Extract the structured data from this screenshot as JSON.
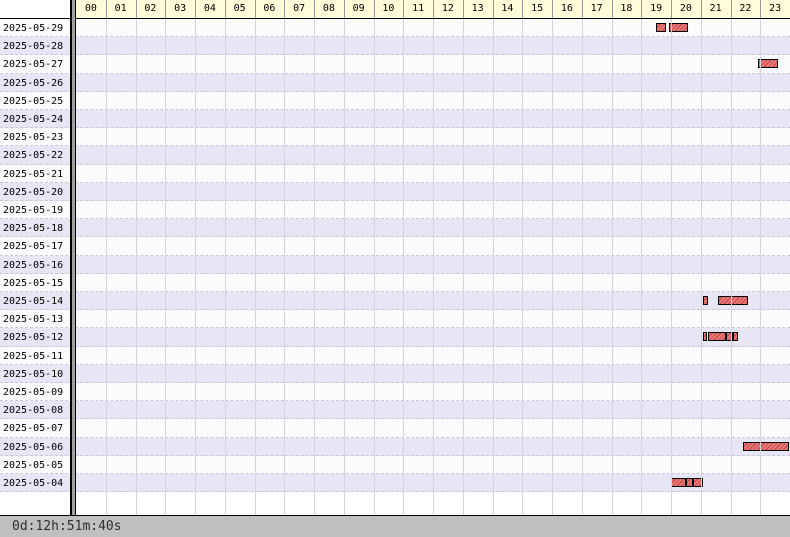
{
  "columns": [
    "00",
    "01",
    "02",
    "03",
    "04",
    "05",
    "06",
    "07",
    "08",
    "09",
    "10",
    "11",
    "12",
    "13",
    "14",
    "15",
    "16",
    "17",
    "18",
    "19",
    "20",
    "21",
    "22",
    "23"
  ],
  "rows": [
    {
      "date": "2025-05-29",
      "mark": false,
      "sessions": [
        {
          "start": "19:30",
          "end": "19:50"
        },
        {
          "start": "19:55",
          "end": "20:35"
        }
      ]
    },
    {
      "date": "2025-05-28",
      "mark": true,
      "sessions": []
    },
    {
      "date": "2025-05-27",
      "mark": false,
      "sessions": [
        {
          "start": "22:55",
          "end": "23:35"
        }
      ]
    },
    {
      "date": "2025-05-26",
      "mark": true,
      "sessions": []
    },
    {
      "date": "2025-05-25",
      "mark": true,
      "sessions": []
    },
    {
      "date": "2025-05-24",
      "mark": true,
      "sessions": []
    },
    {
      "date": "2025-05-23",
      "mark": true,
      "sessions": []
    },
    {
      "date": "2025-05-22",
      "mark": true,
      "sessions": []
    },
    {
      "date": "2025-05-21",
      "mark": true,
      "sessions": []
    },
    {
      "date": "2025-05-20",
      "mark": true,
      "sessions": []
    },
    {
      "date": "2025-05-19",
      "mark": true,
      "sessions": []
    },
    {
      "date": "2025-05-18",
      "mark": true,
      "sessions": []
    },
    {
      "date": "2025-05-17",
      "mark": true,
      "sessions": []
    },
    {
      "date": "2025-05-16",
      "mark": true,
      "sessions": []
    },
    {
      "date": "2025-05-15",
      "mark": true,
      "sessions": []
    },
    {
      "date": "2025-05-14",
      "mark": false,
      "sessions": [
        {
          "start": "21:05",
          "end": "21:15"
        },
        {
          "start": "21:35",
          "end": "22:35"
        }
      ]
    },
    {
      "date": "2025-05-13",
      "mark": true,
      "sessions": []
    },
    {
      "date": "2025-05-12",
      "mark": false,
      "sessions": [
        {
          "start": "21:05",
          "end": "21:10"
        },
        {
          "start": "21:15",
          "end": "21:50"
        },
        {
          "start": "21:50",
          "end": "22:05"
        },
        {
          "start": "22:05",
          "end": "22:15"
        }
      ]
    },
    {
      "date": "2025-05-11",
      "mark": true,
      "sessions": []
    },
    {
      "date": "2025-05-10",
      "mark": true,
      "sessions": []
    },
    {
      "date": "2025-05-09",
      "mark": true,
      "sessions": []
    },
    {
      "date": "2025-05-08",
      "mark": true,
      "sessions": []
    },
    {
      "date": "2025-05-07",
      "mark": true,
      "sessions": []
    },
    {
      "date": "2025-05-06",
      "mark": false,
      "sessions": [
        {
          "start": "22:25",
          "end": "23:59"
        }
      ]
    },
    {
      "date": "2025-05-05",
      "mark": true,
      "sessions": []
    },
    {
      "date": "2025-05-04",
      "mark": false,
      "sessions": [
        {
          "start": "20:00",
          "end": "20:30"
        },
        {
          "start": "20:30",
          "end": "20:45"
        },
        {
          "start": "20:45",
          "end": "21:05"
        }
      ]
    }
  ],
  "status": {
    "total_time": "0d:12h:51m:40s"
  }
}
